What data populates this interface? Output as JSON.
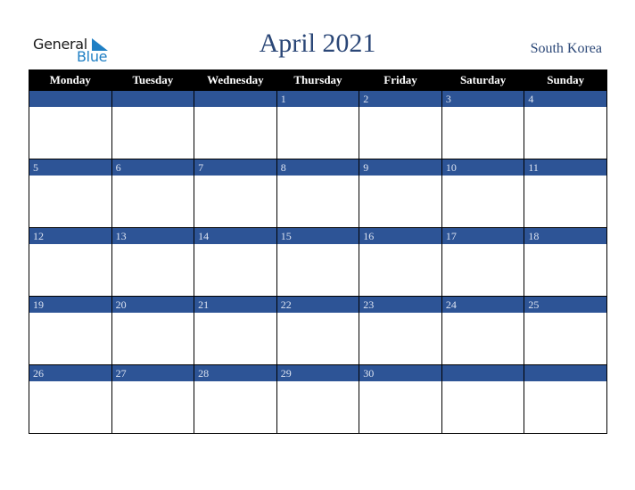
{
  "logo": {
    "word1": "General",
    "word2": "Blue"
  },
  "title": "April 2021",
  "country": "South Korea",
  "colors": {
    "header_bg": "#000000",
    "band": "#2d5496",
    "title": "#2b4777",
    "logo_blue": "#1f7fc4"
  },
  "weekdays": [
    "Monday",
    "Tuesday",
    "Wednesday",
    "Thursday",
    "Friday",
    "Saturday",
    "Sunday"
  ],
  "weeks": [
    [
      "",
      "",
      "",
      "1",
      "2",
      "3",
      "4"
    ],
    [
      "5",
      "6",
      "7",
      "8",
      "9",
      "10",
      "11"
    ],
    [
      "12",
      "13",
      "14",
      "15",
      "16",
      "17",
      "18"
    ],
    [
      "19",
      "20",
      "21",
      "22",
      "23",
      "24",
      "25"
    ],
    [
      "26",
      "27",
      "28",
      "29",
      "30",
      "",
      ""
    ]
  ]
}
